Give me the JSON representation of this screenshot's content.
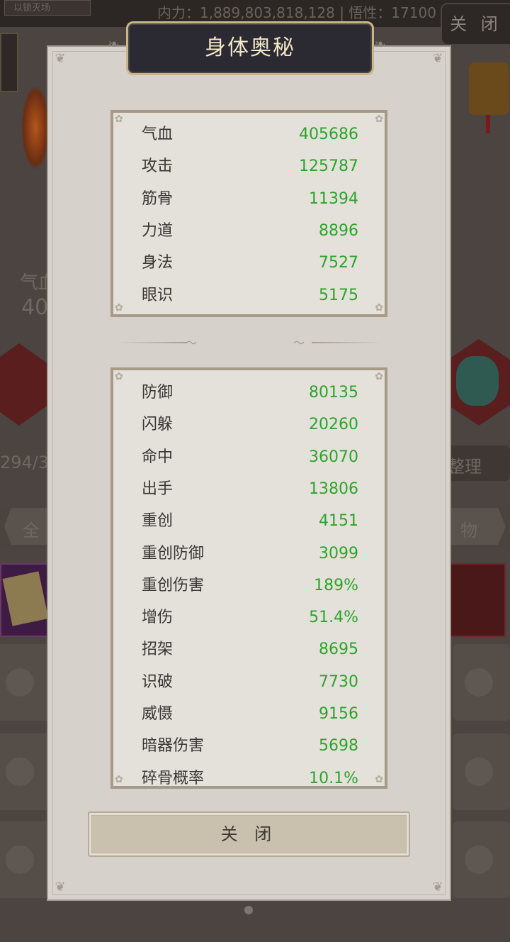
{
  "background": {
    "top_status": "内力：1,889,803,818,128 | 悟性：17100",
    "top_left_label": "以锁灭场",
    "close_label": "关 闭",
    "left_stat_label": "气血",
    "left_stat_value": "40",
    "capacity_text": "294/33",
    "sort_label": "整理",
    "tab_all": "全",
    "tab_items": "物"
  },
  "modal": {
    "title": "身体奥秘",
    "primary_stats": [
      {
        "label": "气血",
        "value": "405686"
      },
      {
        "label": "攻击",
        "value": "125787"
      },
      {
        "label": "筋骨",
        "value": "11394"
      },
      {
        "label": "力道",
        "value": "8896"
      },
      {
        "label": "身法",
        "value": "7527"
      },
      {
        "label": "眼识",
        "value": "5175"
      }
    ],
    "secondary_stats": [
      {
        "label": "防御",
        "value": "80135"
      },
      {
        "label": "闪躲",
        "value": "20260"
      },
      {
        "label": "命中",
        "value": "36070"
      },
      {
        "label": "出手",
        "value": "13806"
      },
      {
        "label": "重创",
        "value": "4151"
      },
      {
        "label": "重创防御",
        "value": "3099"
      },
      {
        "label": "重创伤害",
        "value": "189%"
      },
      {
        "label": "增伤",
        "value": "51.4%"
      },
      {
        "label": "招架",
        "value": "8695"
      },
      {
        "label": "识破",
        "value": "7730"
      },
      {
        "label": "威慑",
        "value": "9156"
      },
      {
        "label": "暗器伤害",
        "value": "5698"
      },
      {
        "label": "碎骨概率",
        "value": "10.1%"
      }
    ],
    "close_button": "关 闭"
  },
  "colors": {
    "stat_value": "#2aa52a",
    "title_text": "#f3e6c6",
    "title_plate": "#2b2a33",
    "panel": "#d6d1cb"
  }
}
